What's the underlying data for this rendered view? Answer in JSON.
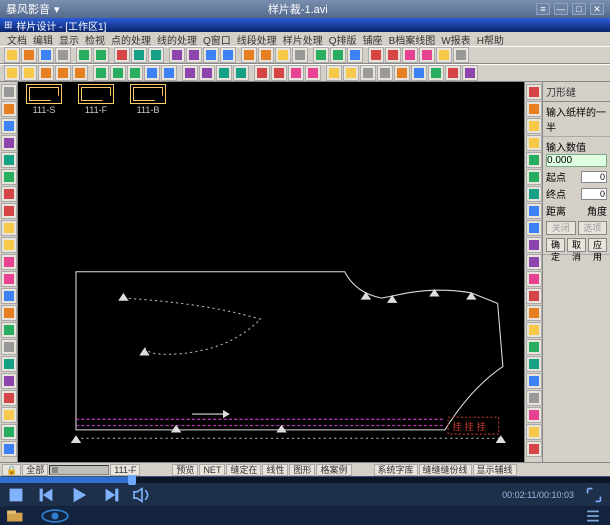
{
  "player": {
    "app_name": "暴风影音",
    "doc_title": "样片裁-1.avi",
    "time_elapsed": "00:02:11",
    "time_total": "00:10:03",
    "progress_pct": 21
  },
  "cad": {
    "title": "样片设计 - [工作区1]",
    "menu": [
      "文档",
      "编辑",
      "显示",
      "检视",
      "点的处理",
      "线的处理",
      "Q窗口",
      "线段处理",
      "样片处理",
      "Q排版",
      "铺座",
      "B档案线图",
      "W报表",
      "H帮助"
    ],
    "thumbs": [
      {
        "label": "111-S"
      },
      {
        "label": "111-F"
      },
      {
        "label": "111-B"
      }
    ],
    "right_panel": {
      "header": "刀形缝",
      "prompt": "输入纸样的一半",
      "input_label": "输入数值",
      "input_value": "0.000",
      "fields": [
        {
          "label": "起点",
          "value": "0"
        },
        {
          "label": "终点",
          "value": "0"
        },
        {
          "label": "距离",
          "value": ""
        },
        {
          "label": "角度",
          "value": ""
        }
      ],
      "btns_row1": [
        "关闭",
        "选项"
      ],
      "btns_row2": [
        "确定",
        "取消",
        "应用"
      ]
    },
    "status": {
      "lock": "🔒",
      "layer": "全部",
      "piece": "111-F",
      "segs": [
        "预览",
        "NET",
        "缝定在",
        "线性",
        "图形",
        "格案例",
        "",
        "系统字库",
        "缝缝缝份线",
        "显示辅线"
      ]
    }
  }
}
